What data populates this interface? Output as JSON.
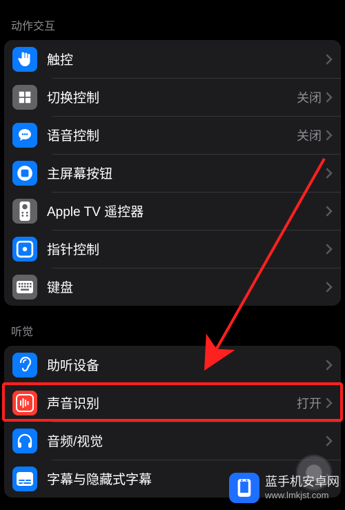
{
  "sections": [
    {
      "id": "interaction",
      "header": "动作交互",
      "items": [
        {
          "id": "touch",
          "label": "触控",
          "value": "",
          "icon": "hand-icon",
          "icon_bg": "blue"
        },
        {
          "id": "switch-control",
          "label": "切换控制",
          "value": "关闭",
          "icon": "grid-icon",
          "icon_bg": "gray"
        },
        {
          "id": "voice-control",
          "label": "语音控制",
          "value": "关闭",
          "icon": "speech-bubble-icon",
          "icon_bg": "blue"
        },
        {
          "id": "home-button",
          "label": "主屏幕按钮",
          "value": "",
          "icon": "home-circle-icon",
          "icon_bg": "blue"
        },
        {
          "id": "appletv-remote",
          "label": "Apple TV 遥控器",
          "value": "",
          "icon": "remote-icon",
          "icon_bg": "gray"
        },
        {
          "id": "pointer-control",
          "label": "指针控制",
          "value": "",
          "icon": "pointer-box-icon",
          "icon_bg": "blue"
        },
        {
          "id": "keyboard",
          "label": "键盘",
          "value": "",
          "icon": "keyboard-icon",
          "icon_bg": "gray"
        }
      ]
    },
    {
      "id": "hearing",
      "header": "听觉",
      "items": [
        {
          "id": "hearing-devices",
          "label": "助听设备",
          "value": "",
          "icon": "ear-icon",
          "icon_bg": "blue"
        },
        {
          "id": "sound-recognition",
          "label": "声音识别",
          "value": "打开",
          "icon": "waveform-icon",
          "icon_bg": "red",
          "highlighted": true
        },
        {
          "id": "audio-visual",
          "label": "音频/视觉",
          "value": "",
          "icon": "headphones-icon",
          "icon_bg": "blue"
        },
        {
          "id": "subtitles",
          "label": "字幕与隐藏式字幕",
          "value": "",
          "icon": "caption-icon",
          "icon_bg": "blue"
        }
      ]
    }
  ],
  "watermark": {
    "line1": "蓝手机安卓网",
    "line2": "www.lmkjst.com"
  },
  "colors": {
    "accent_blue": "#0a7aff",
    "icon_gray": "#636366",
    "icon_red": "#ff3b30",
    "highlight": "#ff2020"
  },
  "annotation": {
    "highlight_item": "sound-recognition",
    "arrow_points_to": "sound-recognition"
  }
}
